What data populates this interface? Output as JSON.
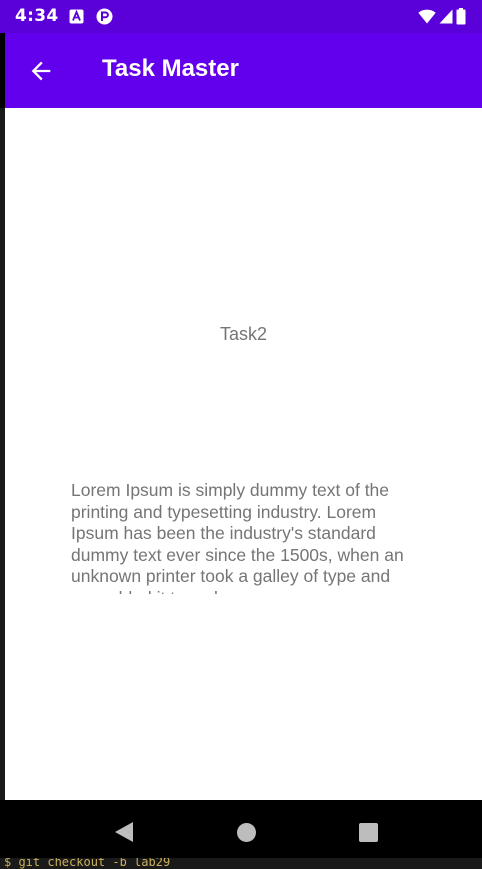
{
  "status_bar": {
    "time": "4:34",
    "notification_icons": [
      "a-letter-notification-icon",
      "p-letter-notification-icon"
    ],
    "system_icons": [
      "wifi-icon",
      "cell-signal-icon",
      "battery-icon"
    ]
  },
  "app_bar": {
    "title": "Task Master",
    "back_icon": "arrow-back-icon",
    "background_color": "#6200ee"
  },
  "task": {
    "title": "Task2",
    "description": "Lorem Ipsum is simply dummy text of the printing and typesetting industry. Lorem Ipsum has been the industry's standard dummy text ever since the 1500s, when an unknown printer took a galley of type and scrambled it to make"
  },
  "host_terminal": {
    "text": "$ git checkout -b lab29"
  },
  "navigation_bar": {
    "buttons": [
      "nav-back-icon",
      "nav-home-icon",
      "nav-recents-icon"
    ]
  }
}
